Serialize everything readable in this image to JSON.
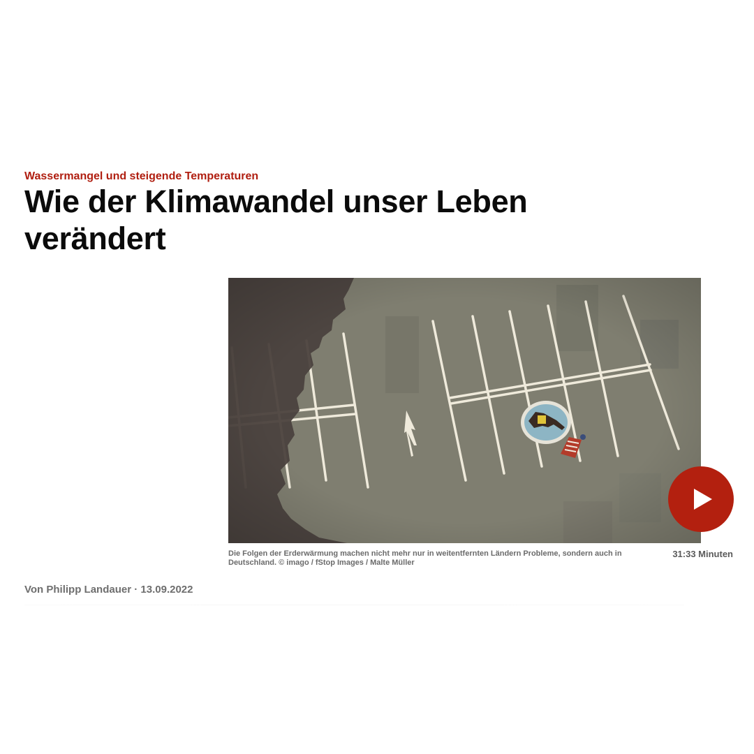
{
  "article": {
    "kicker": "Wassermangel und steigende Temperaturen",
    "headline": "Wie der Klimawandel unser Leben verändert",
    "byline": {
      "author": "Von Philipp Landauer",
      "separator": " · ",
      "date": "13.09.2022"
    }
  },
  "media": {
    "image_subject": "illustration-parking-lot-paddling-pool",
    "caption": "Die Folgen der Erderwärmung machen nicht mehr nur in weitentfernten Ländern Probleme, sondern auch in Deutschland. © imago / fStop Images / Malte Müller",
    "duration": "31:33 Minuten",
    "play_icon": "play-icon"
  },
  "colors": {
    "accent": "#b01e10",
    "play_button": "#b3200f",
    "asphalt": "#807f72",
    "shade": "#4a403c",
    "markings": "#f1eedf"
  }
}
